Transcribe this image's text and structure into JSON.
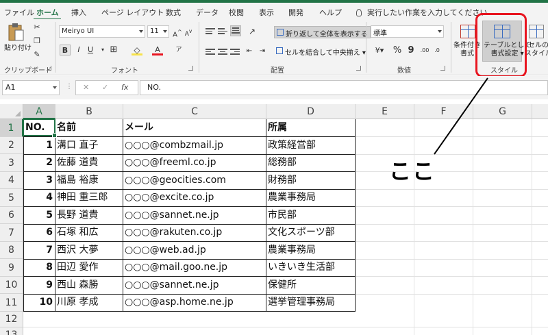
{
  "menu": {
    "tabs": [
      "ファイル",
      "ホーム",
      "挿入",
      "ページ レイアウト",
      "数式",
      "データ",
      "校閲",
      "表示",
      "開発",
      "ヘルプ"
    ],
    "active_tab": "ホーム",
    "tell_me_placeholder": "実行したい作業を入力してください"
  },
  "ribbon": {
    "clipboard": {
      "paste_label": "貼り付け",
      "group_label": "クリップボード"
    },
    "font": {
      "font_name": "Meiryo UI",
      "font_size": "11",
      "bold": "B",
      "italic": "I",
      "underline": "U",
      "grow": "A",
      "shrink": "A",
      "font_color_letter": "A",
      "group_label": "フォント"
    },
    "alignment": {
      "wrap_text": "折り返して全体を表示する",
      "merge_center": "セルを結合して中央揃え",
      "group_label": "配置"
    },
    "number": {
      "format": "標準",
      "percent": "%",
      "comma": "9",
      "group_label": "数値"
    },
    "styles": {
      "conditional_label_1": "条件付き",
      "conditional_label_2": "書式",
      "format_table_label_1": "テーブルとして",
      "format_table_label_2": "書式設定",
      "cell_styles_label_1": "セルの",
      "cell_styles_label_2": "スタイル",
      "group_label": "スタイル"
    },
    "accent_color": "#217346",
    "highlight_color": "#e8141f"
  },
  "formula_bar": {
    "name_box": "A1",
    "cancel_symbol": "✕",
    "enter_symbol": "✓",
    "fx_symbol": "fx",
    "content": "NO."
  },
  "sheet": {
    "columns": [
      "A",
      "B",
      "C",
      "D",
      "E",
      "F",
      "G"
    ],
    "rows": [
      "1",
      "2",
      "3",
      "4",
      "5",
      "6",
      "7",
      "8",
      "9",
      "10",
      "11",
      "12",
      "13"
    ],
    "headers": [
      "NO.",
      "名前",
      "メール",
      "所属"
    ],
    "records": [
      [
        "1",
        "溝口 直子",
        "○○○@combzmail.jp",
        "政策経営部"
      ],
      [
        "2",
        "佐藤 道貴",
        "○○○@freeml.co.jp",
        "総務部"
      ],
      [
        "3",
        "福島 裕康",
        "○○○@geocities.com",
        "財務部"
      ],
      [
        "4",
        "神田 重三郎",
        "○○○@excite.co.jp",
        "農業事務局"
      ],
      [
        "5",
        "長野 道貴",
        "○○○@sannet.ne.jp",
        "市民部"
      ],
      [
        "6",
        "石塚 和広",
        "○○○@rakuten.co.jp",
        "文化スポーツ部"
      ],
      [
        "7",
        "西沢 大夢",
        "○○○@web.ad.jp",
        "農業事務局"
      ],
      [
        "8",
        "田辺 愛作",
        "○○○@mail.goo.ne.jp",
        "いきいき生活部"
      ],
      [
        "9",
        "西山 森勝",
        "○○○@sannet.ne.jp",
        "保健所"
      ],
      [
        "10",
        "川原 孝成",
        "○○○@asp.home.ne.jp",
        "選挙管理事務局"
      ]
    ]
  },
  "annotation": {
    "text": "ここ"
  }
}
